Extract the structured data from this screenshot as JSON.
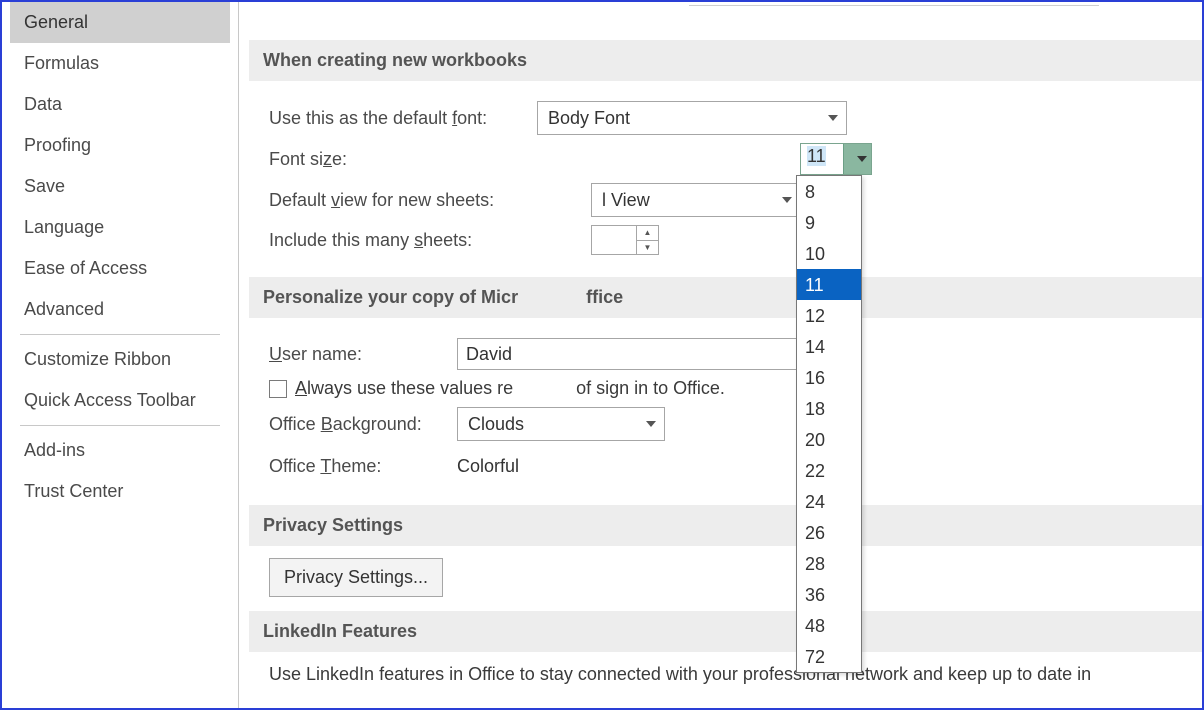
{
  "sidebar": {
    "items": [
      {
        "label": "General",
        "selected": true
      },
      {
        "label": "Formulas"
      },
      {
        "label": "Data"
      },
      {
        "label": "Proofing"
      },
      {
        "label": "Save"
      },
      {
        "label": "Language"
      },
      {
        "label": "Ease of Access"
      },
      {
        "label": "Advanced"
      }
    ],
    "items2": [
      {
        "label": "Customize Ribbon"
      },
      {
        "label": "Quick Access Toolbar"
      }
    ],
    "items3": [
      {
        "label": "Add-ins"
      },
      {
        "label": "Trust Center"
      }
    ]
  },
  "sections": {
    "new_workbooks": {
      "title": "When creating new workbooks",
      "default_font_label_pre": "Use this as the default ",
      "default_font_label_u": "f",
      "default_font_label_post": "ont:",
      "default_font_value": "Body Font",
      "font_size_label_pre": "Font si",
      "font_size_label_u": "z",
      "font_size_label_post": "e:",
      "font_size_value": "11",
      "font_size_options": [
        "8",
        "9",
        "10",
        "11",
        "12",
        "14",
        "16",
        "18",
        "20",
        "22",
        "24",
        "26",
        "28",
        "36",
        "48",
        "72"
      ],
      "font_size_selected_index": 3,
      "default_view_label_pre": "Default ",
      "default_view_label_u": "v",
      "default_view_label_post": "iew for new sheets:",
      "default_view_value_visible": "l View",
      "include_sheets_label_pre": "Include this many ",
      "include_sheets_label_u": "s",
      "include_sheets_label_post": "heets:",
      "include_sheets_value": ""
    },
    "personalize": {
      "title_prefix": "Personalize your copy of Micr",
      "title_suffix": "ffice",
      "user_name_label_u": "U",
      "user_name_label_post": "ser name:",
      "user_name_value": "David",
      "always_label_u": "A",
      "always_label_mid": "lways use these values re",
      "always_label_suffix": " of sign in to Office.",
      "office_bg_label_pre": "Office ",
      "office_bg_label_u": "B",
      "office_bg_label_post": "ackground:",
      "office_bg_value": "Clouds",
      "office_theme_label_pre": "Office ",
      "office_theme_label_u": "T",
      "office_theme_label_post": "heme:",
      "office_theme_value": "Colorful"
    },
    "privacy": {
      "title": "Privacy Settings",
      "button": "Privacy Settings..."
    },
    "linkedin": {
      "title": "LinkedIn Features",
      "body": "Use LinkedIn features in Office to stay connected with your professional network and keep up to date in"
    }
  }
}
